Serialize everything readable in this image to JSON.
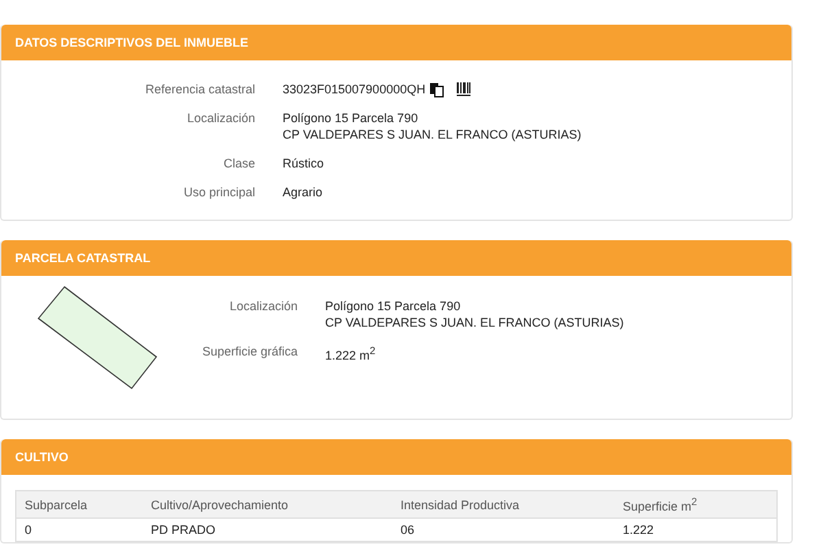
{
  "sections": [
    {
      "kind": "fields",
      "title": "DATOS DESCRIPTIVOS DEL INMUEBLE",
      "fields": [
        {
          "label": "Referencia catastral",
          "lines": [
            "33023F015007900000QH"
          ],
          "icons": true
        },
        {
          "label": "Localización",
          "lines": [
            "Polígono 15 Parcela 790",
            "CP VALDEPARES S JUAN. EL FRANCO (ASTURIAS)"
          ],
          "icons": false
        },
        {
          "label": "Clase",
          "lines": [
            "Rústico"
          ],
          "icons": false
        },
        {
          "label": "Uso principal",
          "lines": [
            "Agrario"
          ],
          "icons": false
        }
      ]
    },
    {
      "kind": "parcel",
      "title": "PARCELA CATASTRAL",
      "fields": [
        {
          "label": "Localización",
          "lines": [
            "Polígono 15 Parcela 790",
            "CP VALDEPARES S JUAN. EL FRANCO (ASTURIAS)"
          ],
          "icons": false
        },
        {
          "label": "Superficie gráfica",
          "lines": [
            "1.222 m$^{2}$"
          ],
          "icons": false
        }
      ]
    },
    {
      "kind": "table",
      "title": "CULTIVO",
      "columns": [
        "Subparcela",
        "Cultivo/Aprovechamiento",
        "Intensidad Productiva",
        "Superficie m$^{2}$"
      ],
      "rows": [
        [
          "0",
          "PD PRADO",
          "06",
          "1.222"
        ]
      ]
    }
  ]
}
